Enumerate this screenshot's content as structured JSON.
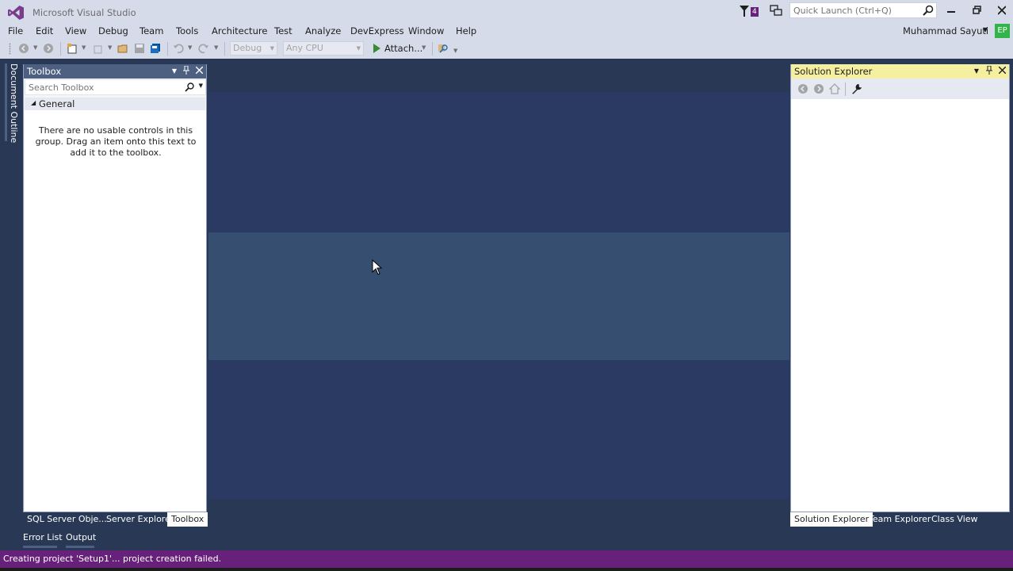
{
  "window": {
    "title": "Microsoft Visual Studio",
    "notification_count": "4",
    "quick_launch_placeholder": "Quick Launch (Ctrl+Q)",
    "controls": [
      "minimize-icon",
      "restore-icon",
      "close-icon"
    ]
  },
  "menu": {
    "items": [
      "File",
      "Edit",
      "View",
      "Debug",
      "Team",
      "Tools",
      "Architecture",
      "Test",
      "Analyze",
      "DevExpress",
      "Window",
      "Help"
    ],
    "user_name": "Muhammad Sayuti",
    "avatar_initials": "EP"
  },
  "toolbar": {
    "config_combo": "Debug",
    "platform_combo": "Any CPU",
    "attach_label": "Attach..."
  },
  "side_tabs": {
    "document_outline": "Document Outline"
  },
  "toolbox": {
    "title": "Toolbox",
    "search_placeholder": "Search Toolbox",
    "group_name": "General",
    "empty_message": "There are no usable controls in this group. Drag an item onto this text to add it to the toolbox."
  },
  "left_panel_tabs": [
    "SQL Server Obje...",
    "Server Explorer",
    "Toolbox"
  ],
  "solution_explorer": {
    "title": "Solution Explorer"
  },
  "right_panel_tabs": [
    "Solution Explorer",
    "Team Explorer",
    "Class View"
  ],
  "bottom_tabs": [
    "Error List",
    "Output"
  ],
  "status": {
    "message": "Creating project 'Setup1'... project creation failed."
  },
  "colors": {
    "accent": "#68217a",
    "panel_header": "#4d6082",
    "background": "#293955",
    "active_header": "#f5f0a0"
  }
}
